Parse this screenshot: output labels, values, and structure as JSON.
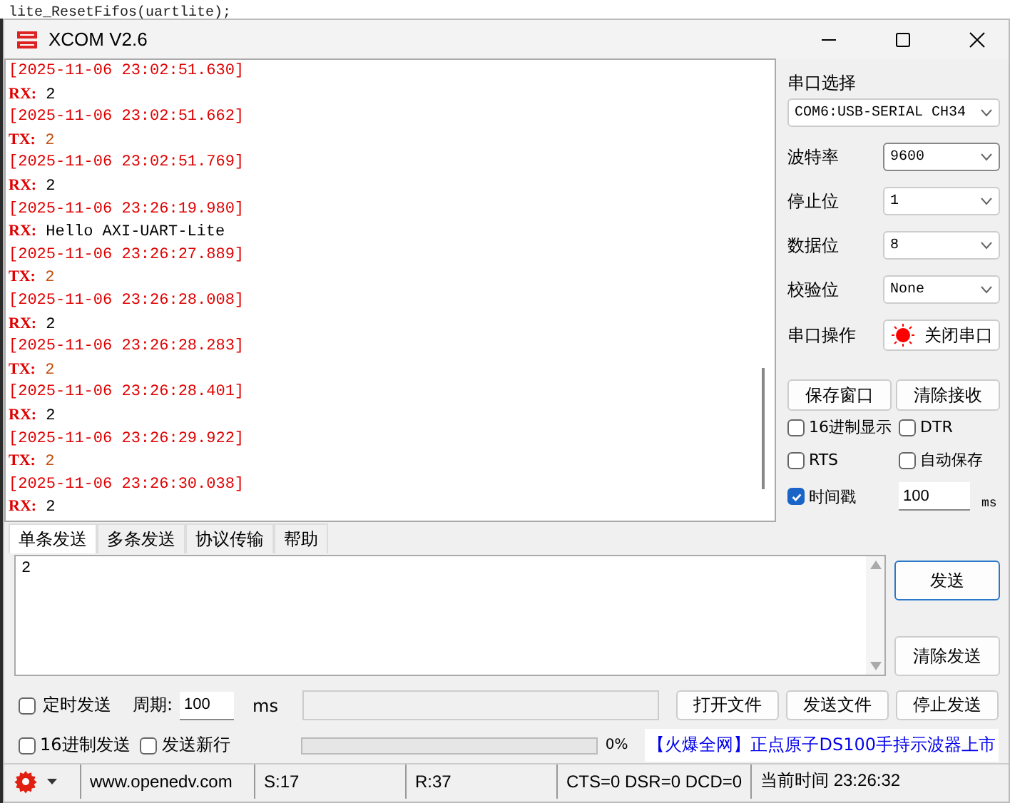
{
  "background": {
    "code_line": "lite_ResetFifos(uartlite);"
  },
  "window": {
    "title": "XCOM V2.6"
  },
  "log": [
    {
      "time": "[2025-11-06 23:02:51.630]",
      "dir": "RX:",
      "kind": "rx",
      "data": "2"
    },
    {
      "time": "[2025-11-06 23:02:51.662]",
      "dir": "TX:",
      "kind": "tx",
      "data": "2"
    },
    {
      "time": "[2025-11-06 23:02:51.769]",
      "dir": "RX:",
      "kind": "rx",
      "data": "2"
    },
    {
      "time": "[2025-11-06 23:26:19.980]",
      "dir": "RX:",
      "kind": "rx",
      "data": "Hello AXI-UART-Lite"
    },
    {
      "time": "[2025-11-06 23:26:27.889]",
      "dir": "TX:",
      "kind": "tx",
      "data": "2"
    },
    {
      "time": "[2025-11-06 23:26:28.008]",
      "dir": "RX:",
      "kind": "rx",
      "data": "2"
    },
    {
      "time": "[2025-11-06 23:26:28.283]",
      "dir": "TX:",
      "kind": "tx",
      "data": "2"
    },
    {
      "time": "[2025-11-06 23:26:28.401]",
      "dir": "RX:",
      "kind": "rx",
      "data": "2"
    },
    {
      "time": "[2025-11-06 23:26:29.922]",
      "dir": "TX:",
      "kind": "tx",
      "data": "2"
    },
    {
      "time": "[2025-11-06 23:26:30.038]",
      "dir": "RX:",
      "kind": "rx",
      "data": "2"
    }
  ],
  "serial": {
    "port_label": "串口选择",
    "port": "COM6:USB-SERIAL CH34",
    "fields": [
      {
        "label": "波特率",
        "value": "9600",
        "focused": true
      },
      {
        "label": "停止位",
        "value": "1",
        "focused": false
      },
      {
        "label": "数据位",
        "value": "8",
        "focused": false
      },
      {
        "label": "校验位",
        "value": "None",
        "focused": false
      }
    ],
    "operation_label": "串口操作",
    "open": true,
    "toggle_button": "关闭串口"
  },
  "receive_buttons": [
    "保存窗口",
    "清除接收"
  ],
  "options": [
    {
      "label": "16进制显示",
      "checked": false
    },
    {
      "label": "DTR",
      "checked": false
    },
    {
      "label": "RTS",
      "checked": false
    },
    {
      "label": "自动保存",
      "checked": false
    },
    {
      "label": "时间戳",
      "checked": true
    }
  ],
  "interval": {
    "value": "100",
    "unit": "ms"
  },
  "tabs": [
    {
      "label": "单条发送",
      "selected": true
    },
    {
      "label": "多条发送",
      "selected": false
    },
    {
      "label": "协议传输",
      "selected": false
    },
    {
      "label": "帮助",
      "selected": false
    }
  ],
  "send_text": "2",
  "send_buttons": [
    "发送",
    "清除发送"
  ],
  "timer": {
    "label": "定时发送",
    "checked": false,
    "period_label": "周期:",
    "period": "100",
    "unit": "ms"
  },
  "send_options": [
    {
      "label": "16进制发送",
      "checked": false
    },
    {
      "label": "发送新行",
      "checked": false
    }
  ],
  "file_buttons": [
    "打开文件",
    "发送文件",
    "停止发送"
  ],
  "progress": {
    "level": 0,
    "reading": "0%"
  },
  "ad": "【火爆全网】正点原子DS100手持示波器上市",
  "status": {
    "url": "www.openedv.com",
    "sent": "S:17",
    "received": "R:37",
    "lines": "CTS=0 DSR=0 DCD=0",
    "time": "当前时间 23:26:32"
  }
}
